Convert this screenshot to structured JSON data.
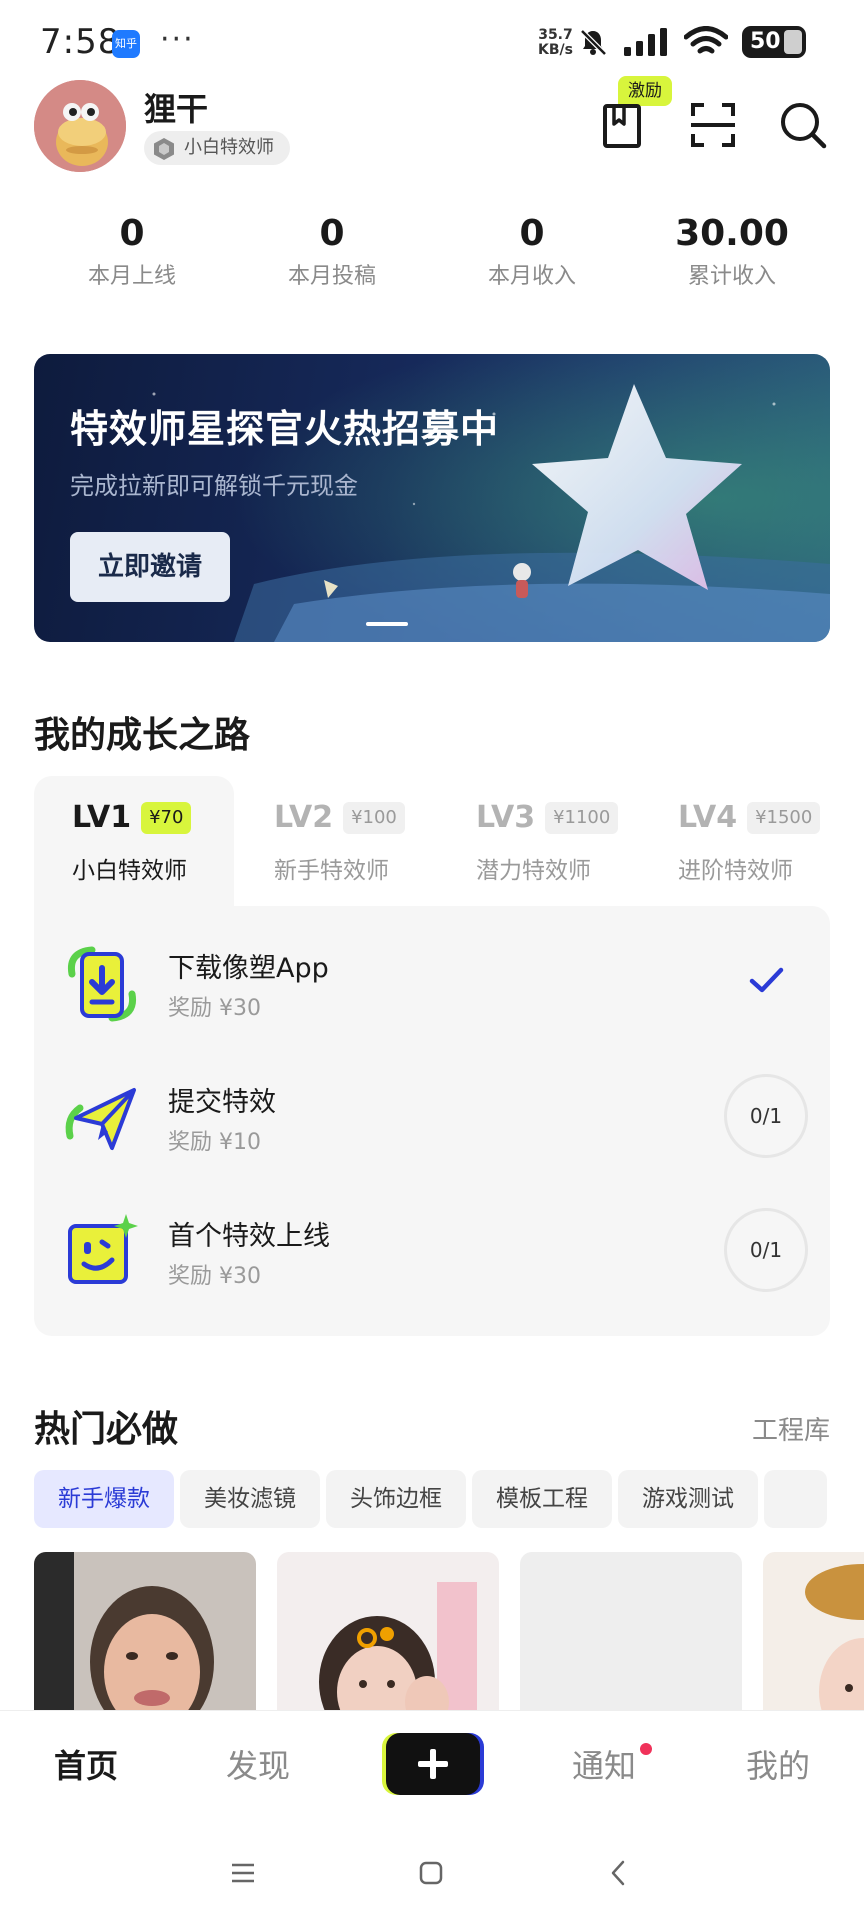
{
  "status_bar": {
    "time": "7:58",
    "app_badge": "知乎",
    "more": "···",
    "net_speed_value": "35.7",
    "net_speed_unit": "KB/s",
    "battery": "50"
  },
  "profile": {
    "name": "狸干",
    "level_tag": "小白特效师",
    "incentive_badge": "激励"
  },
  "stats": [
    {
      "value": "0",
      "label": "本月上线"
    },
    {
      "value": "0",
      "label": "本月投稿"
    },
    {
      "value": "0",
      "label": "本月收入"
    },
    {
      "value": "30.00",
      "label": "累计收入"
    }
  ],
  "banner": {
    "title": "特效师星探官火热招募中",
    "subtitle": "完成拉新即可解锁千元现金",
    "button": "立即邀请"
  },
  "growth": {
    "title": "我的成长之路",
    "levels": [
      {
        "name": "LV1",
        "price": "¥70",
        "label": "小白特效师",
        "active": true
      },
      {
        "name": "LV2",
        "price": "¥100",
        "label": "新手特效师",
        "active": false
      },
      {
        "name": "LV3",
        "price": "¥1100",
        "label": "潜力特效师",
        "active": false
      },
      {
        "name": "LV4",
        "price": "¥1500",
        "label": "进阶特效师",
        "active": false
      }
    ],
    "tasks": [
      {
        "name": "下载像塑App",
        "reward": "奖励 ¥30",
        "status": "done",
        "icon": "phone-download-icon"
      },
      {
        "name": "提交特效",
        "reward": "奖励 ¥10",
        "progress": "0/1",
        "icon": "paper-plane-icon"
      },
      {
        "name": "首个特效上线",
        "reward": "奖励 ¥30",
        "progress": "0/1",
        "icon": "smiley-sparkle-icon"
      }
    ]
  },
  "hot": {
    "title": "热门必做",
    "more": "工程库",
    "chips": [
      "新手爆款",
      "美妆滤镜",
      "头饰边框",
      "模板工程",
      "游戏测试"
    ],
    "active_chip": 0
  },
  "bottom_nav": {
    "items": [
      "首页",
      "发现",
      "通知",
      "我的"
    ],
    "active": 0
  },
  "colors": {
    "accent_lime": "#d8f53c",
    "accent_blue": "#2b3bd6",
    "notification_dot": "#f0325a"
  }
}
